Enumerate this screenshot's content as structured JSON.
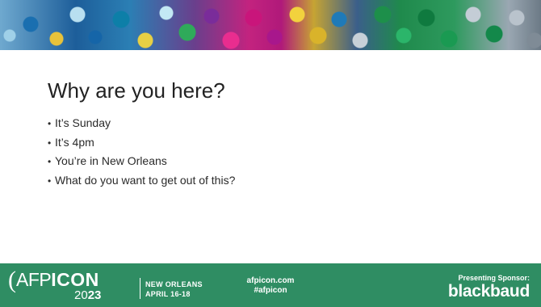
{
  "slide": {
    "title": "Why are you here?",
    "bullets": [
      "It’s Sunday",
      "It’s 4pm",
      "You’re in New Orleans",
      "What do you want to get out of this?"
    ],
    "bullet_marker": "•"
  },
  "footer": {
    "logo": {
      "paren": "(",
      "afp": "AFP",
      "icon": "ICON",
      "year_pre": "20",
      "year_post": "23",
      "city": "NEW ORLEANS",
      "dates": "APRIL 16-18"
    },
    "website": "afpicon.com",
    "hashtag": "#afpicon",
    "sponsor_label": "Presenting Sponsor:",
    "sponsor_name": "blackbaud"
  },
  "colors": {
    "footer_bg": "#2f8d63",
    "title_text": "#222222",
    "body_text": "#2a2a2a"
  }
}
